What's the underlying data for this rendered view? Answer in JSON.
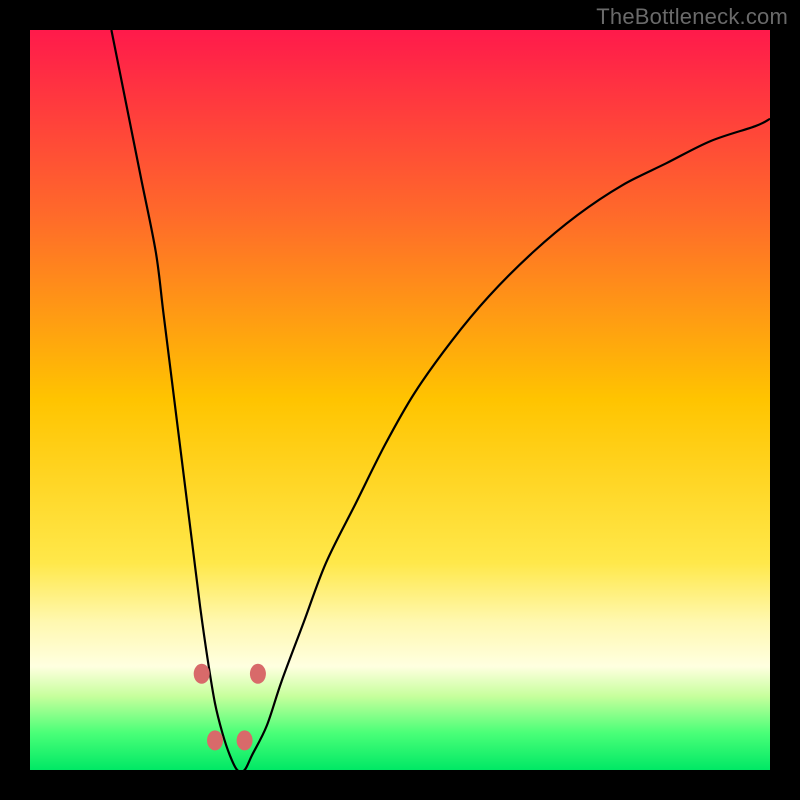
{
  "watermark": "TheBottleneck.com",
  "chart_data": {
    "type": "line",
    "title": "",
    "xlabel": "",
    "ylabel": "",
    "xlim": [
      0,
      100
    ],
    "ylim": [
      0,
      100
    ],
    "gradient_stops": [
      {
        "offset": 0,
        "color": "#ff1a4b"
      },
      {
        "offset": 25,
        "color": "#ff6a2a"
      },
      {
        "offset": 50,
        "color": "#ffc400"
      },
      {
        "offset": 72,
        "color": "#ffe84a"
      },
      {
        "offset": 80,
        "color": "#fff8b0"
      },
      {
        "offset": 86,
        "color": "#ffffe0"
      },
      {
        "offset": 90,
        "color": "#c7ff9d"
      },
      {
        "offset": 95,
        "color": "#4aff78"
      },
      {
        "offset": 100,
        "color": "#00e865"
      }
    ],
    "series": [
      {
        "name": "bottleneck-curve",
        "x": [
          11,
          13,
          15,
          17,
          18,
          19,
          20,
          21,
          22,
          23,
          24,
          25,
          26,
          27,
          28,
          29,
          30,
          32,
          34,
          37,
          40,
          44,
          48,
          52,
          57,
          62,
          68,
          74,
          80,
          86,
          92,
          98,
          100
        ],
        "values": [
          100,
          90,
          80,
          70,
          62,
          54,
          46,
          38,
          30,
          22,
          15,
          9,
          5,
          2,
          0,
          0,
          2,
          6,
          12,
          20,
          28,
          36,
          44,
          51,
          58,
          64,
          70,
          75,
          79,
          82,
          85,
          87,
          88
        ]
      }
    ],
    "markers": {
      "name": "highlight-points",
      "color": "#d86a6a",
      "radius_px": 8,
      "points": [
        {
          "x": 23.2,
          "y": 13
        },
        {
          "x": 25.0,
          "y": 4
        },
        {
          "x": 29.0,
          "y": 4
        },
        {
          "x": 30.8,
          "y": 13
        }
      ]
    }
  }
}
